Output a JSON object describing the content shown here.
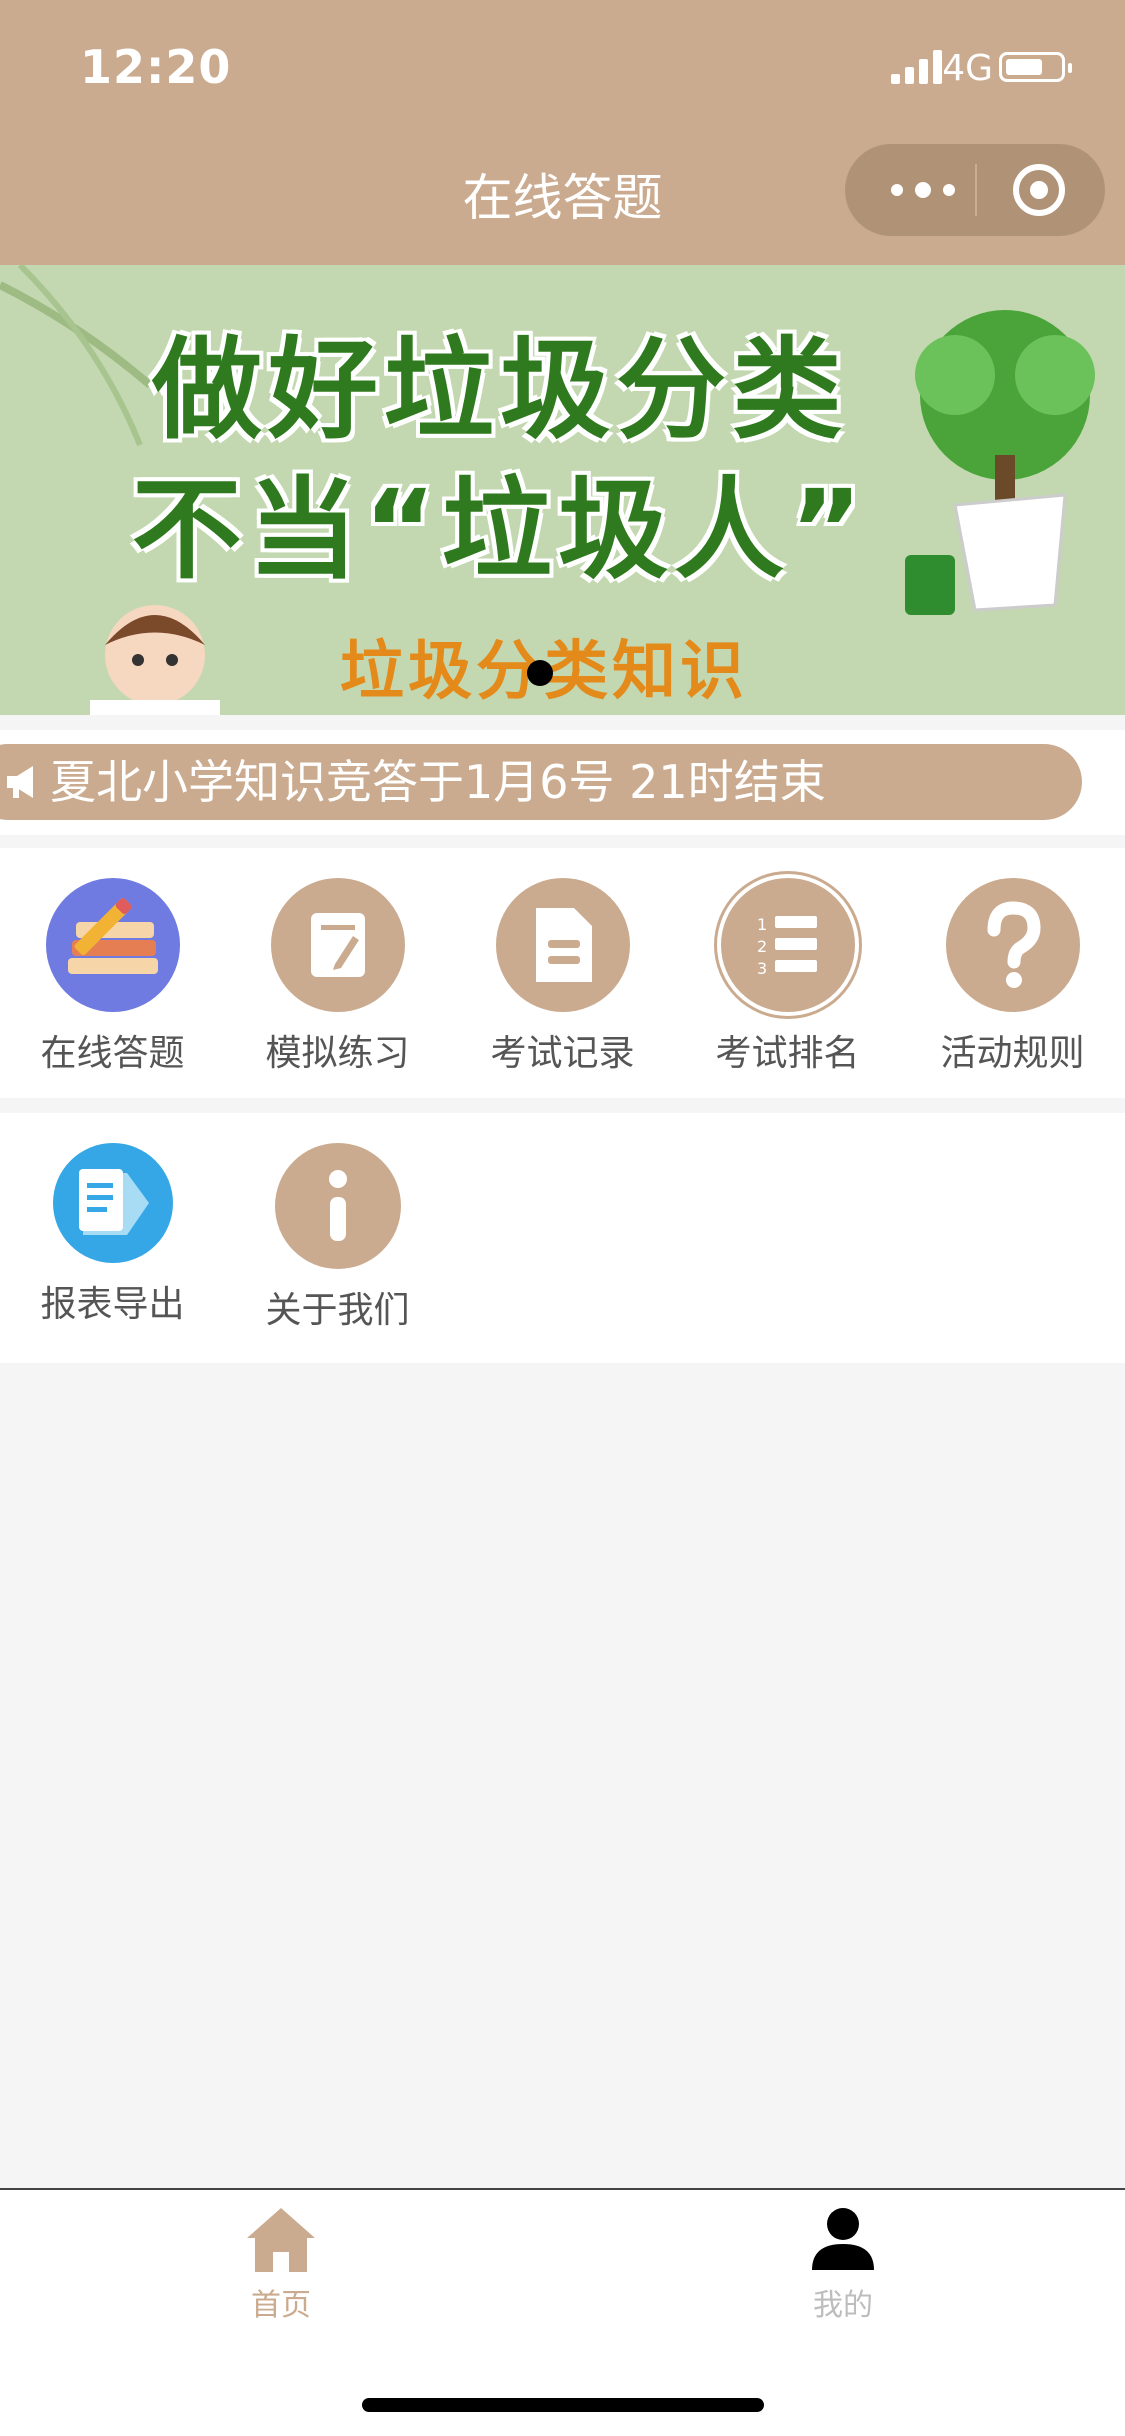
{
  "status": {
    "time": "12:20",
    "network": "4G"
  },
  "nav": {
    "title": "在线答题"
  },
  "banner": {
    "line1": "做好垃圾分类",
    "line2": "不当“垃圾人”",
    "subtitle": "垃圾分类知识"
  },
  "notice": {
    "text": "夏北小学知识竞答于1月6号 21时结束"
  },
  "menu": {
    "row1": [
      {
        "label": "在线答题",
        "icon": "books-pencil-icon"
      },
      {
        "label": "模拟练习",
        "icon": "note-pen-icon"
      },
      {
        "label": "考试记录",
        "icon": "document-icon"
      },
      {
        "label": "考试排名",
        "icon": "ranking-list-icon"
      },
      {
        "label": "活动规则",
        "icon": "question-icon"
      }
    ],
    "row2": [
      {
        "label": "报表导出",
        "icon": "export-document-icon"
      },
      {
        "label": "关于我们",
        "icon": "info-icon"
      }
    ]
  },
  "tabbar": {
    "items": [
      {
        "label": "首页",
        "icon": "home-icon",
        "active": true
      },
      {
        "label": "我的",
        "icon": "user-icon",
        "active": false
      }
    ]
  },
  "colors": {
    "brand": "#cbab8f",
    "active_tab": "#cbab8f",
    "inactive_tab": "#bdbdbd"
  }
}
